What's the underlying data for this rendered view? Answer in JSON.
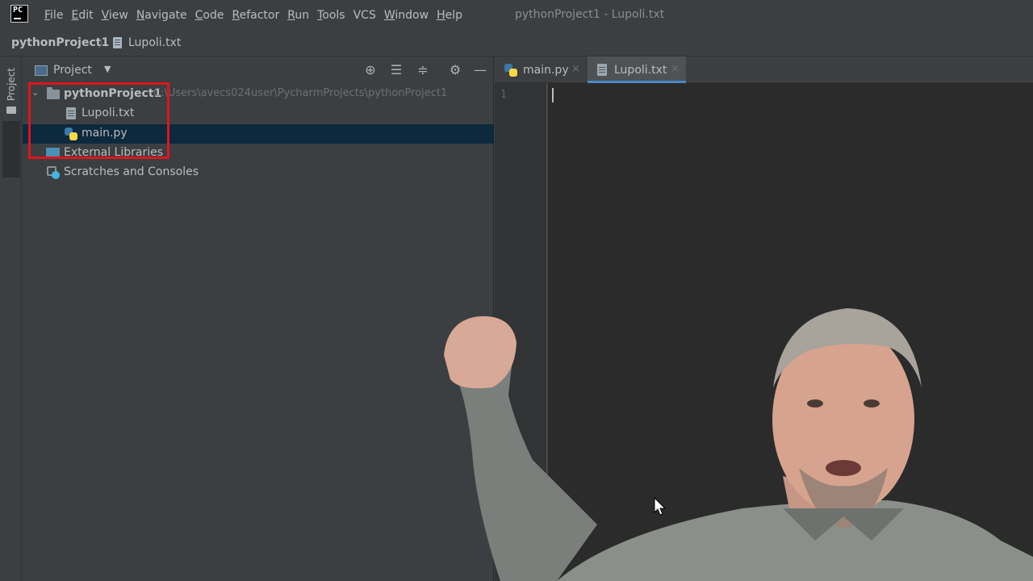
{
  "menubar": {
    "app_logo": "PC",
    "items": [
      {
        "mnemonic": "F",
        "rest": "ile"
      },
      {
        "mnemonic": "E",
        "rest": "dit"
      },
      {
        "mnemonic": "V",
        "rest": "iew"
      },
      {
        "mnemonic": "N",
        "rest": "avigate"
      },
      {
        "mnemonic": "C",
        "rest": "ode"
      },
      {
        "mnemonic": "R",
        "rest": "efactor"
      },
      {
        "mnemonic": "R",
        "rest": "un"
      },
      {
        "mnemonic": "T",
        "rest": "ools"
      },
      {
        "mnemonic": "",
        "rest": "VCS"
      },
      {
        "mnemonic": "W",
        "rest": "indow"
      },
      {
        "mnemonic": "H",
        "rest": "elp"
      }
    ],
    "window_title": "pythonProject1 - Lupoli.txt"
  },
  "navbar": {
    "project": "pythonProject1",
    "separator": "〉",
    "file": "Lupoli.txt"
  },
  "tool_stripe": {
    "project_tab": "Project"
  },
  "project_panel": {
    "title": "Project",
    "dropdown_icon": "▼",
    "buttons": {
      "locate": "⊕",
      "expand": "☰",
      "collapse": "≑",
      "settings": "⚙",
      "hide": "—"
    },
    "tree": {
      "root_arrow": "⌄",
      "root_name": "pythonProject1",
      "root_path": "C:\\Users\\avecs024user\\PycharmProjects\\pythonProject1",
      "file1": "Lupoli.txt",
      "file2": "main.py",
      "external_libraries": "External Libraries",
      "scratches": "Scratches and Consoles"
    }
  },
  "editor": {
    "tabs": [
      {
        "label": "main.py",
        "close": "×"
      },
      {
        "label": "Lupoli.txt",
        "close": "×"
      }
    ],
    "line_number": "1"
  },
  "colors": {
    "highlight_box": "#e0141b",
    "selection": "#0d293e",
    "active_tab_underline": "#4a88c7"
  }
}
